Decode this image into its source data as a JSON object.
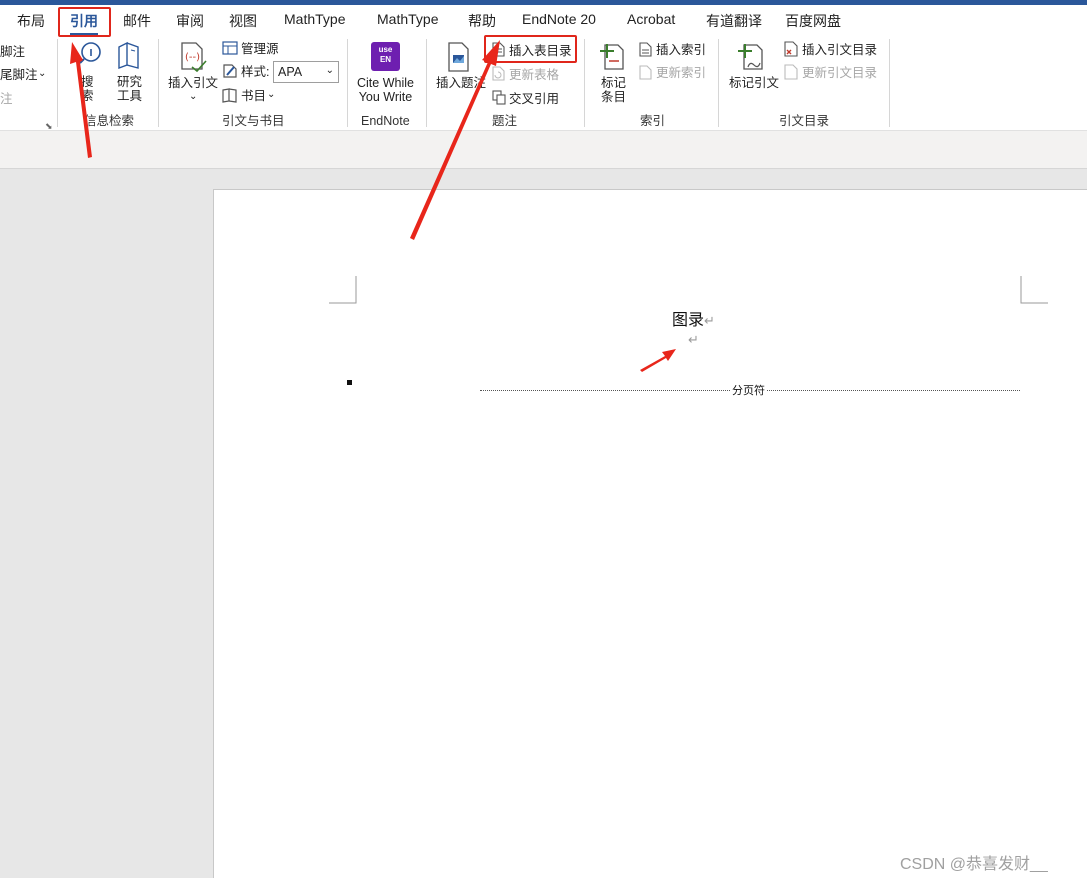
{
  "tabs": [
    "布局",
    "引用",
    "邮件",
    "审阅",
    "视图",
    "MathType",
    "MathType",
    "帮助",
    "EndNote 20",
    "Acrobat",
    "有道翻译",
    "百度网盘"
  ],
  "ribbon": {
    "left_partial": [
      "脚注",
      "尾脚注",
      "注"
    ],
    "search": "搜\n索",
    "research_tools": "研究\n工具",
    "group_info_search": "信息检索",
    "insert_citation": "插入引文",
    "manage_sources": "管理源",
    "style_label": "样式:",
    "style_value": "APA",
    "bibliography": "书目",
    "group_citations": "引文与书目",
    "endnote_badge": "use\nEN",
    "cite_while_you_write": "Cite While\nYou Write",
    "group_endnote": "EndNote",
    "insert_caption": "插入题注",
    "insert_table_of_figures": "插入表目录",
    "update_table": "更新表格",
    "cross_reference": "交叉引用",
    "group_captions": "题注",
    "mark_entry": "标记\n条目",
    "insert_index": "插入索引",
    "update_index": "更新索引",
    "group_index": "索引",
    "mark_citation": "标记引文",
    "insert_table_of_authorities": "插入引文目录",
    "update_table_of_authorities": "更新引文目录",
    "group_table_of_authorities": "引文目录"
  },
  "document": {
    "heading": "图录",
    "paragraph_mark": "↵",
    "page_break_label": "分页符"
  },
  "watermark": "CSDN @恭喜发财__",
  "colors": {
    "accent": "#2b579a",
    "highlight": "#e0261b"
  }
}
